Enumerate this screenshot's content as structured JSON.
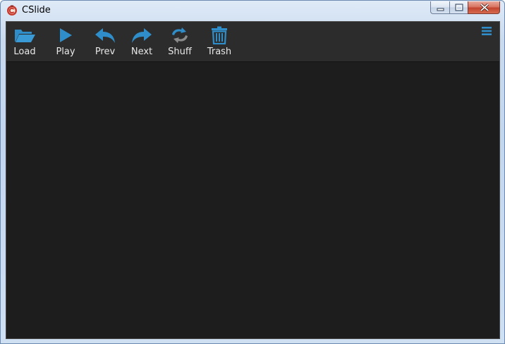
{
  "window": {
    "title": "CSlide",
    "app_icon": "cslide-logo-icon",
    "controls": [
      "minimize-icon",
      "maximize-icon",
      "close-icon"
    ]
  },
  "toolbar": {
    "buttons": [
      {
        "label": "Load",
        "icon": "folder-open-icon"
      },
      {
        "label": "Play",
        "icon": "play-icon"
      },
      {
        "label": "Prev",
        "icon": "reply-arrow-icon"
      },
      {
        "label": "Next",
        "icon": "forward-arrow-icon"
      },
      {
        "label": "Shuff",
        "icon": "shuffle-icon"
      },
      {
        "label": "Trash",
        "icon": "trash-icon"
      }
    ],
    "menu_icon": "hamburger-menu-icon"
  },
  "colors": {
    "accent": "#2f8ec9",
    "shuffle": "#8a8a8a",
    "toolbar_bg": "#2c2c2c",
    "stage_bg": "#1d1d1d"
  }
}
